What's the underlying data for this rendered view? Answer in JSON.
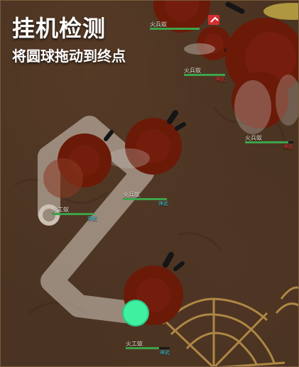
{
  "hud": {
    "title": "挂机检测",
    "subtitle": "将圆球拖动到终点"
  },
  "enemies": [
    {
      "name": "火兵蚁",
      "tag": "",
      "tag_color": "#e03030"
    },
    {
      "name": "火兵蚁",
      "tag": "神武",
      "tag_color": "#e03030"
    },
    {
      "name": "火兵蚁",
      "tag": "神武",
      "tag_color": "#e03030"
    },
    {
      "name": "火兵蚁",
      "tag": "神武",
      "tag_color": "#3bbfd0"
    },
    {
      "name": "火工蚁",
      "tag": "神武",
      "tag_color": "#3bbfd0"
    },
    {
      "name": "火工蚁",
      "tag": "神武",
      "tag_color": "#3bbfd0"
    }
  ],
  "colors": {
    "ground": "#4a3322",
    "ant_body": "#6b1a08",
    "path": "#d8d0c4",
    "ball": "#3ff0a0",
    "web": "#b89048",
    "hp": "#3ea34a"
  }
}
